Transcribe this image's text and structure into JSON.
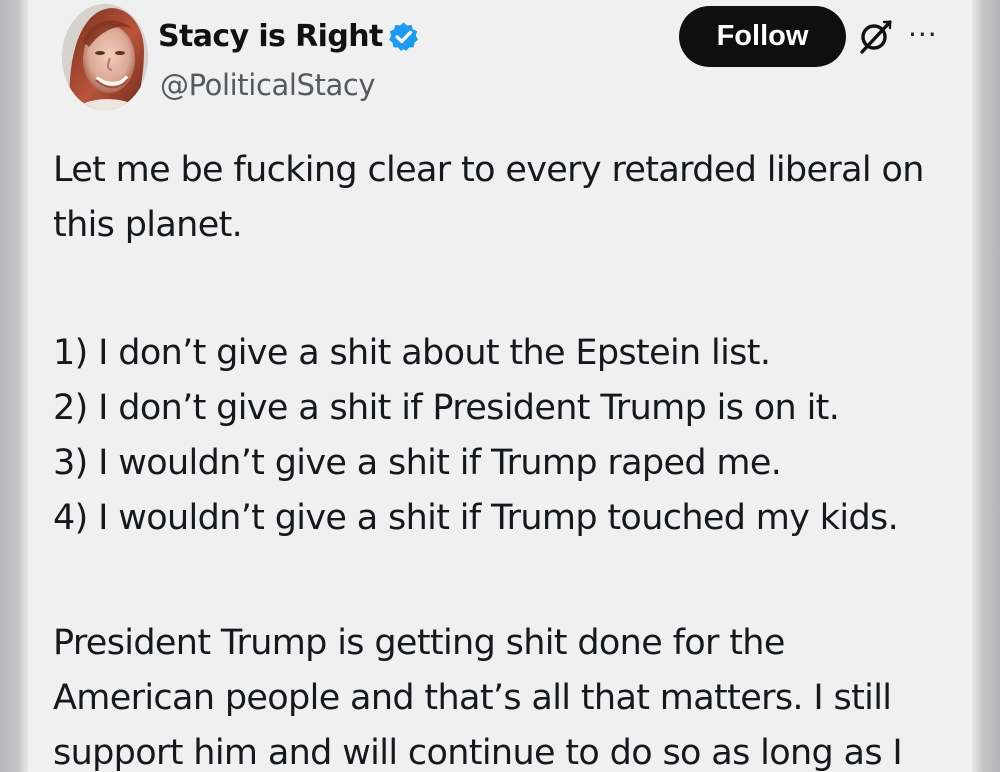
{
  "profile": {
    "display_name": "Stacy is Right",
    "handle": "@PoliticalStacy",
    "verified_icon": "verified-badge-icon",
    "avatar_icon": "profile-photo"
  },
  "actions": {
    "follow_label": "Follow",
    "grok_icon": "grok-icon",
    "more_icon": "more-options-icon",
    "more_glyph": "···"
  },
  "tweet": {
    "lines": [
      "Let me be fucking clear to every retarded liberal on",
      "this planet.",
      "1) I don’t give a shit about the Epstein list.",
      "2) I don’t give a shit if President Trump is on it.",
      "3) I wouldn’t give a shit if Trump raped me.",
      "4) I wouldn’t give a shit if Trump touched my kids.",
      "President Trump is getting shit done for the",
      "American people and that’s all that matters. I still",
      "support him and will continue to do so as long as I"
    ]
  },
  "colors": {
    "background": "#c8c8ca",
    "card": "#f0f0f1",
    "text": "#15191d",
    "secondary_text": "#555a60",
    "verified_blue": "#1d9bf0",
    "button": "#0f0f10"
  }
}
